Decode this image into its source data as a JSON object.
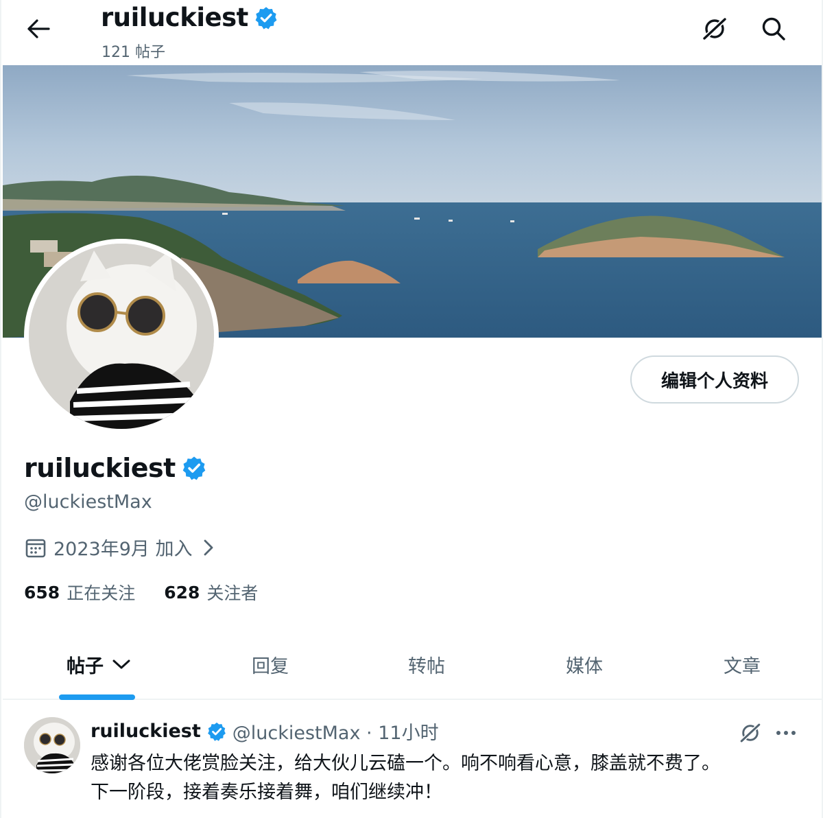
{
  "header": {
    "title": "ruiluckiest",
    "post_count": "121 帖子",
    "back_icon": "arrow-left-icon",
    "grok_icon": "grok-icon",
    "search_icon": "search-icon"
  },
  "profile": {
    "display_name": "ruiluckiest",
    "handle": "@luckiestMax",
    "joined": "2023年9月 加入",
    "edit_button": "编辑个人资料",
    "verified_color": "#1d9bf0",
    "following_count": "658",
    "following_label": "正在关注",
    "followers_count": "628",
    "followers_label": "关注者"
  },
  "tabs": [
    {
      "label": "帖子",
      "active": true
    },
    {
      "label": "回复",
      "active": false
    },
    {
      "label": "转帖",
      "active": false
    },
    {
      "label": "媒体",
      "active": false
    },
    {
      "label": "文章",
      "active": false
    }
  ],
  "post": {
    "name": "ruiluckiest",
    "handle_time": "@luckiestMax · 11小时",
    "text_line1": "感谢各位大佬赏脸关注，给大伙儿云磕一个。响不响看心意，膝盖就不费了。",
    "text_line2": "下一阶段，接着奏乐接着舞，咱们继续冲！"
  },
  "colors": {
    "accent": "#1d9bf0",
    "text_primary": "#0f1419",
    "text_secondary": "#536471"
  }
}
